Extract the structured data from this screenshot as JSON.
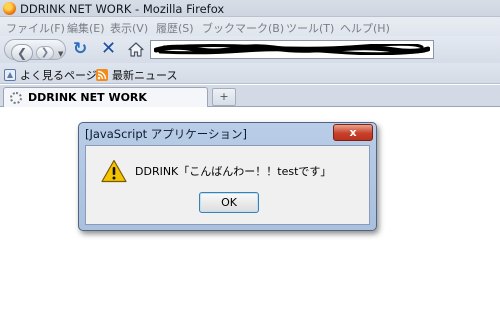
{
  "window": {
    "title": "DDRINK NET WORK - Mozilla Firefox"
  },
  "menu": {
    "items": [
      "ファイル(F)",
      "編集(E)",
      "表示(V)",
      "履歴(S)",
      "ブックマーク(B)",
      "ツール(T)",
      "ヘルプ(H)"
    ]
  },
  "bookmarks": {
    "items": [
      {
        "label": "よく見るページ",
        "icon": "most-visited-icon"
      },
      {
        "label": "最新ニュース",
        "icon": "rss-feed-icon"
      }
    ]
  },
  "tabs": [
    {
      "label": "DDRINK NET WORK",
      "loading": true
    }
  ],
  "newtab_label": "+",
  "dialog": {
    "title": "[JavaScript アプリケーション]",
    "close_label": "x",
    "message": "DDRINK「こんばんわー！！testです」",
    "ok_label": "OK",
    "icon": "warning-icon"
  },
  "colors": {
    "dialog_frame": "#b9cde8",
    "close_button": "#c8412a",
    "warning_yellow": "#f5c400",
    "reload_blue": "#2c6fc0",
    "stop_blue": "#1d4f9c"
  }
}
